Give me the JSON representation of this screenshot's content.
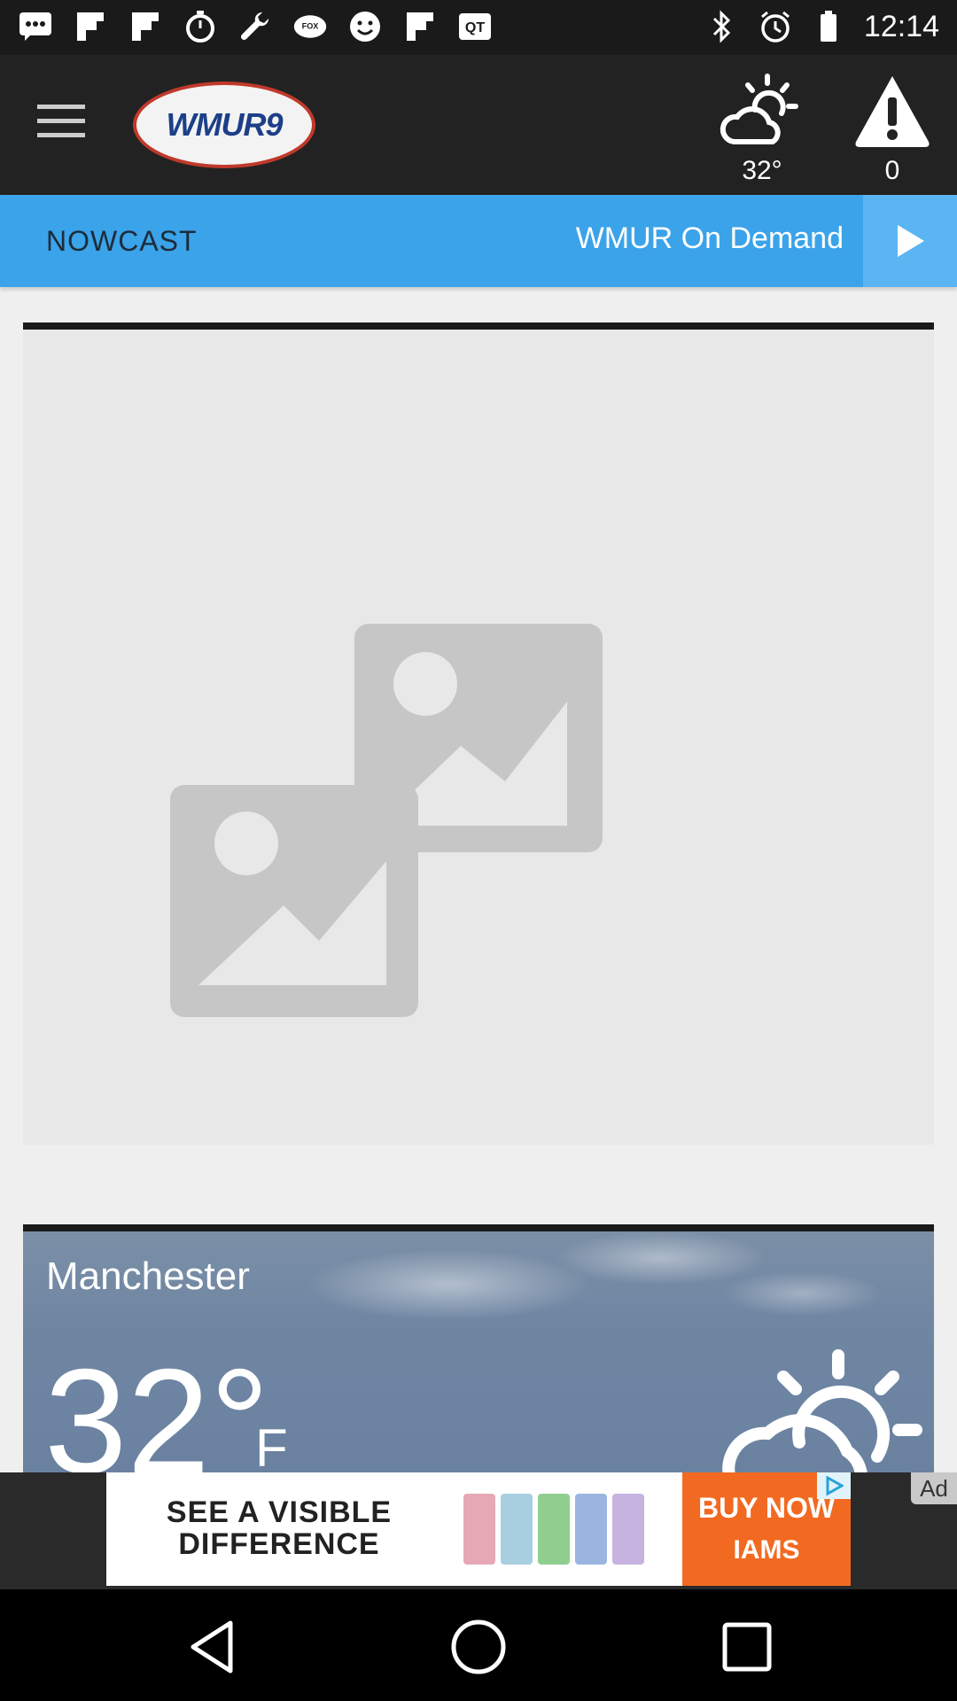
{
  "status_bar": {
    "time": "12:14",
    "icons": [
      "chat-icon",
      "flipboard-icon",
      "flipboard-icon",
      "stopwatch-icon",
      "wrench-icon",
      "fox-sports-icon",
      "smiley-icon",
      "flipboard-icon",
      "qt-icon",
      "bluetooth-icon",
      "alarm-icon",
      "battery-icon"
    ]
  },
  "header": {
    "menu_icon": "hamburger-menu-icon",
    "logo_text": "WMUR9",
    "weather_temp": "32°",
    "alert_count": "0"
  },
  "tabs": {
    "nowcast": "NOWCAST",
    "on_demand": "WMUR On Demand"
  },
  "weather_card": {
    "city": "Manchester",
    "temperature": "32°",
    "unit": "F"
  },
  "ad": {
    "headline": "SEE A VISIBLE DIFFERENCE",
    "cta": "BUY NOW",
    "brand": "IAMS",
    "label": "Ad"
  },
  "colors": {
    "tab_bar": "#3ba3e9",
    "header": "#222222",
    "ad_cta": "#f26a21"
  }
}
